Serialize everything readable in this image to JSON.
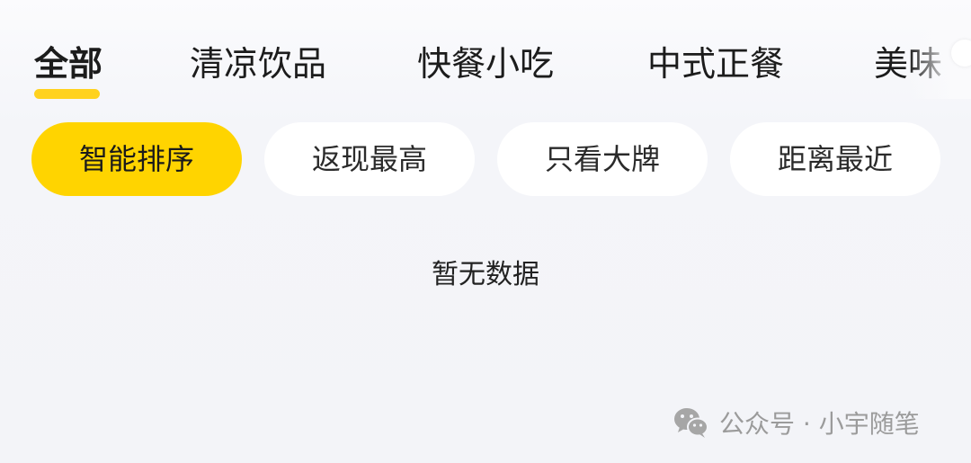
{
  "category_tabs": [
    {
      "label": "全部",
      "active": true
    },
    {
      "label": "清凉饮品",
      "active": false
    },
    {
      "label": "快餐小吃",
      "active": false
    },
    {
      "label": "中式正餐",
      "active": false
    },
    {
      "label": "美味",
      "active": false
    }
  ],
  "sort_chips": [
    {
      "label": "智能排序",
      "active": true
    },
    {
      "label": "返现最高",
      "active": false
    },
    {
      "label": "只看大牌",
      "active": false
    },
    {
      "label": "距离最近",
      "active": false
    }
  ],
  "empty_state": {
    "text": "暂无数据"
  },
  "watermark": {
    "text": "公众号 · 小宇随笔",
    "icon": "wechat-icon"
  },
  "colors": {
    "accent": "#ffd400",
    "underline": "#ffd21f",
    "background": "#f4f5f9",
    "chip_bg": "#ffffff",
    "watermark": "#9b9b9b"
  }
}
